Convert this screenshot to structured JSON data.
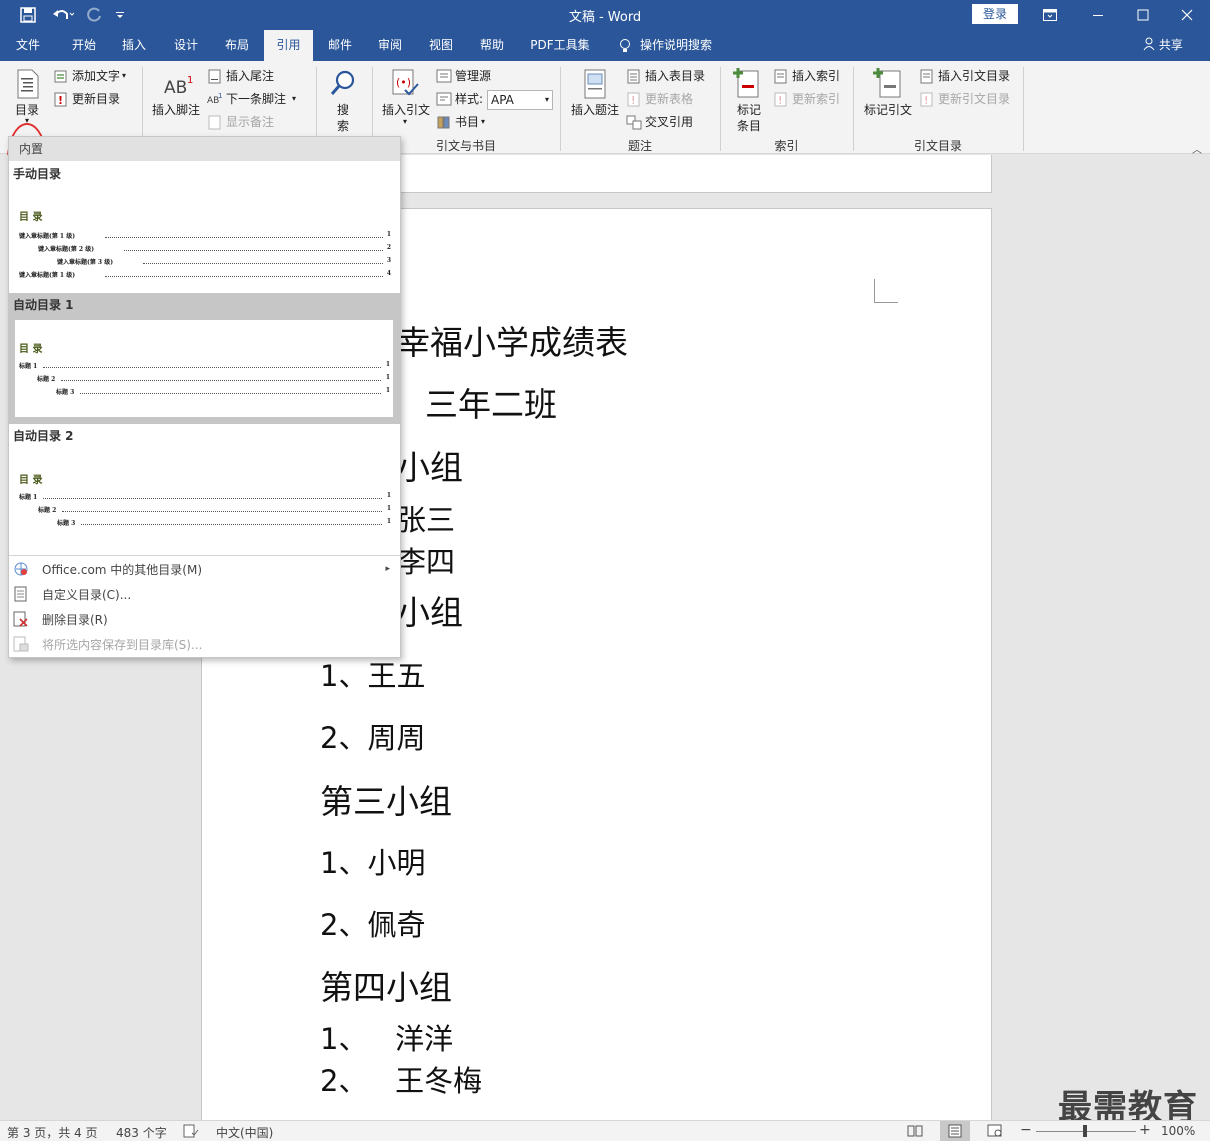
{
  "window": {
    "title": "文稿  -  Word",
    "login_label": "登录",
    "share_label": "共享",
    "undo_icon": "undo-icon",
    "redo_icon": "redo-icon",
    "save_icon": "save-icon"
  },
  "tabs": [
    {
      "label": "文件"
    },
    {
      "label": "开始"
    },
    {
      "label": "插入"
    },
    {
      "label": "设计"
    },
    {
      "label": "布局"
    },
    {
      "label": "引用"
    },
    {
      "label": "邮件"
    },
    {
      "label": "审阅"
    },
    {
      "label": "视图"
    },
    {
      "label": "帮助"
    },
    {
      "label": "PDF工具集"
    },
    {
      "label": "操作说明搜索"
    }
  ],
  "ribbon": {
    "toc": {
      "big_label": "目录",
      "add_text": "添加文字",
      "update_toc": "更新目录"
    },
    "footnotes": {
      "insert_footnote": "插入脚注",
      "insert_endnote": "插入尾注",
      "next_footnote": "下一条脚注",
      "show_notes": "显示备注"
    },
    "research": {
      "search": "搜",
      "search2": "索"
    },
    "citations": {
      "insert_citation": "插入引文",
      "manage_sources": "管理源",
      "style_label": "样式:",
      "style_value": "APA",
      "bibliography": "书目",
      "group": "引文与书目"
    },
    "captions": {
      "insert_caption": "插入题注",
      "insert_table_of_figures": "插入表目录",
      "update_table": "更新表格",
      "cross_reference": "交叉引用",
      "group": "题注"
    },
    "index": {
      "mark_entry1": "标记",
      "mark_entry2": "条目",
      "insert_index": "插入索引",
      "update_index": "更新索引",
      "group": "索引"
    },
    "toa": {
      "mark_citation": "标记引文",
      "insert_toa": "插入引文目录",
      "update_toa": "更新引文目录",
      "group": "引文目录"
    },
    "accent_color": "#2b579a",
    "highlight_color": "#e03030"
  },
  "toc_menu": {
    "header": "内置",
    "manual": {
      "title": "手动目录",
      "heading": "目 录",
      "lines": [
        {
          "text": "键入章标题(第 1 级)",
          "page": "1"
        },
        {
          "text": "键入章标题(第 2 级)",
          "page": "2"
        },
        {
          "text": "键入章标题(第 3 级)",
          "page": "3"
        },
        {
          "text": "键入章标题(第 1 级)",
          "page": "4"
        }
      ]
    },
    "auto1": {
      "title": "自动目录 1",
      "heading": "目 录",
      "lines": [
        {
          "text": "标题 1",
          "page": "1"
        },
        {
          "text": "标题 2",
          "page": "1"
        },
        {
          "text": "标题 3",
          "page": "1"
        }
      ]
    },
    "auto2": {
      "title": "自动目录 2",
      "heading": "目 录",
      "lines": [
        {
          "text": "标题 1",
          "page": "1"
        },
        {
          "text": "标题 2",
          "page": "1"
        },
        {
          "text": "标题 3",
          "page": "1"
        }
      ]
    },
    "commands": [
      {
        "label": "Office.com 中的其他目录(M)",
        "icon": "office-icon",
        "enabled": true
      },
      {
        "label": "自定义目录(C)...",
        "icon": "doc-icon",
        "enabled": true
      },
      {
        "label": "删除目录(R)",
        "icon": "delete-toc-icon",
        "enabled": true
      },
      {
        "label": "将所选内容保存到目录库(S)...",
        "icon": "save-gallery-icon",
        "enabled": false
      }
    ]
  },
  "document": {
    "title": "幸福小学成绩表",
    "class": "三年二班",
    "group1": "小组",
    "g1_items": [
      "张三",
      "李四"
    ],
    "group2": "小组",
    "g2_items": [
      "1、王五",
      "2、周周"
    ],
    "group3": "第三小组",
    "g3_items": [
      "1、小明",
      "2、佩奇"
    ],
    "group4": "第四小组",
    "g4_items": [
      "1、   洋洋",
      "2、   王冬梅"
    ]
  },
  "status": {
    "page": "第 3 页，共 4 页",
    "words": "483 个字",
    "lang": "中文(中国)",
    "zoom": "100%"
  },
  "watermark": "最需教育"
}
